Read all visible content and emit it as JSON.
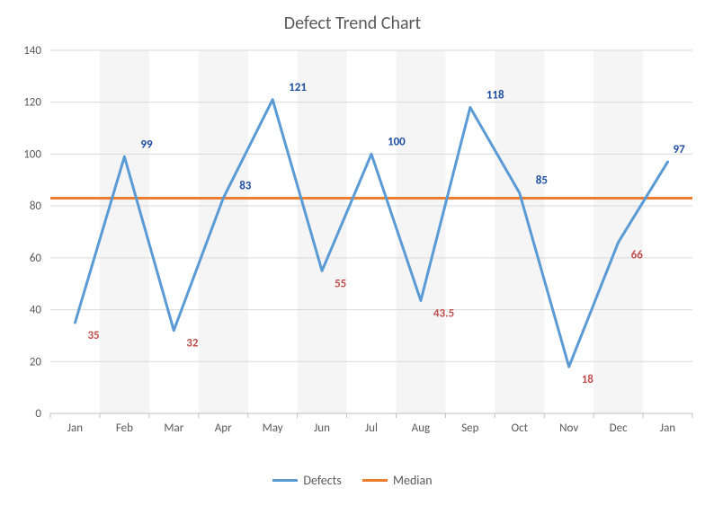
{
  "chart_data": {
    "type": "line",
    "title": "Defect Trend Chart",
    "xlabel": "",
    "ylabel": "",
    "ylim": [
      0,
      140
    ],
    "yticks": [
      0,
      20,
      40,
      60,
      80,
      100,
      120,
      140
    ],
    "categories": [
      "Jan",
      "Feb",
      "Mar",
      "Apr",
      "May",
      "Jun",
      "Jul",
      "Aug",
      "Sep",
      "Oct",
      "Nov",
      "Dec",
      "Jan"
    ],
    "series": [
      {
        "name": "Defects",
        "color": "#5b9bd5",
        "values": [
          35,
          99,
          32,
          83,
          121,
          55,
          100,
          43.5,
          118,
          85,
          18,
          66,
          97
        ]
      },
      {
        "name": "Median",
        "color": "#ed7d31",
        "values": [
          83,
          83,
          83,
          83,
          83,
          83,
          83,
          83,
          83,
          83,
          83,
          83,
          83
        ]
      }
    ],
    "data_labels": [
      {
        "index": 0,
        "value": 35,
        "pos": "below"
      },
      {
        "index": 1,
        "value": 99,
        "pos": "above"
      },
      {
        "index": 2,
        "value": 32,
        "pos": "below"
      },
      {
        "index": 3,
        "value": 83,
        "pos": "above"
      },
      {
        "index": 4,
        "value": 121,
        "pos": "above"
      },
      {
        "index": 5,
        "value": 55,
        "pos": "below"
      },
      {
        "index": 6,
        "value": 100,
        "pos": "above"
      },
      {
        "index": 7,
        "value": 43.5,
        "pos": "below"
      },
      {
        "index": 8,
        "value": 118,
        "pos": "above"
      },
      {
        "index": 9,
        "value": 85,
        "pos": "above"
      },
      {
        "index": 10,
        "value": 18,
        "pos": "below"
      },
      {
        "index": 11,
        "value": 66,
        "pos": "below"
      },
      {
        "index": 12,
        "value": 97,
        "pos": "above"
      }
    ],
    "legend": {
      "defects_label": "Defects",
      "median_label": "Median"
    }
  }
}
